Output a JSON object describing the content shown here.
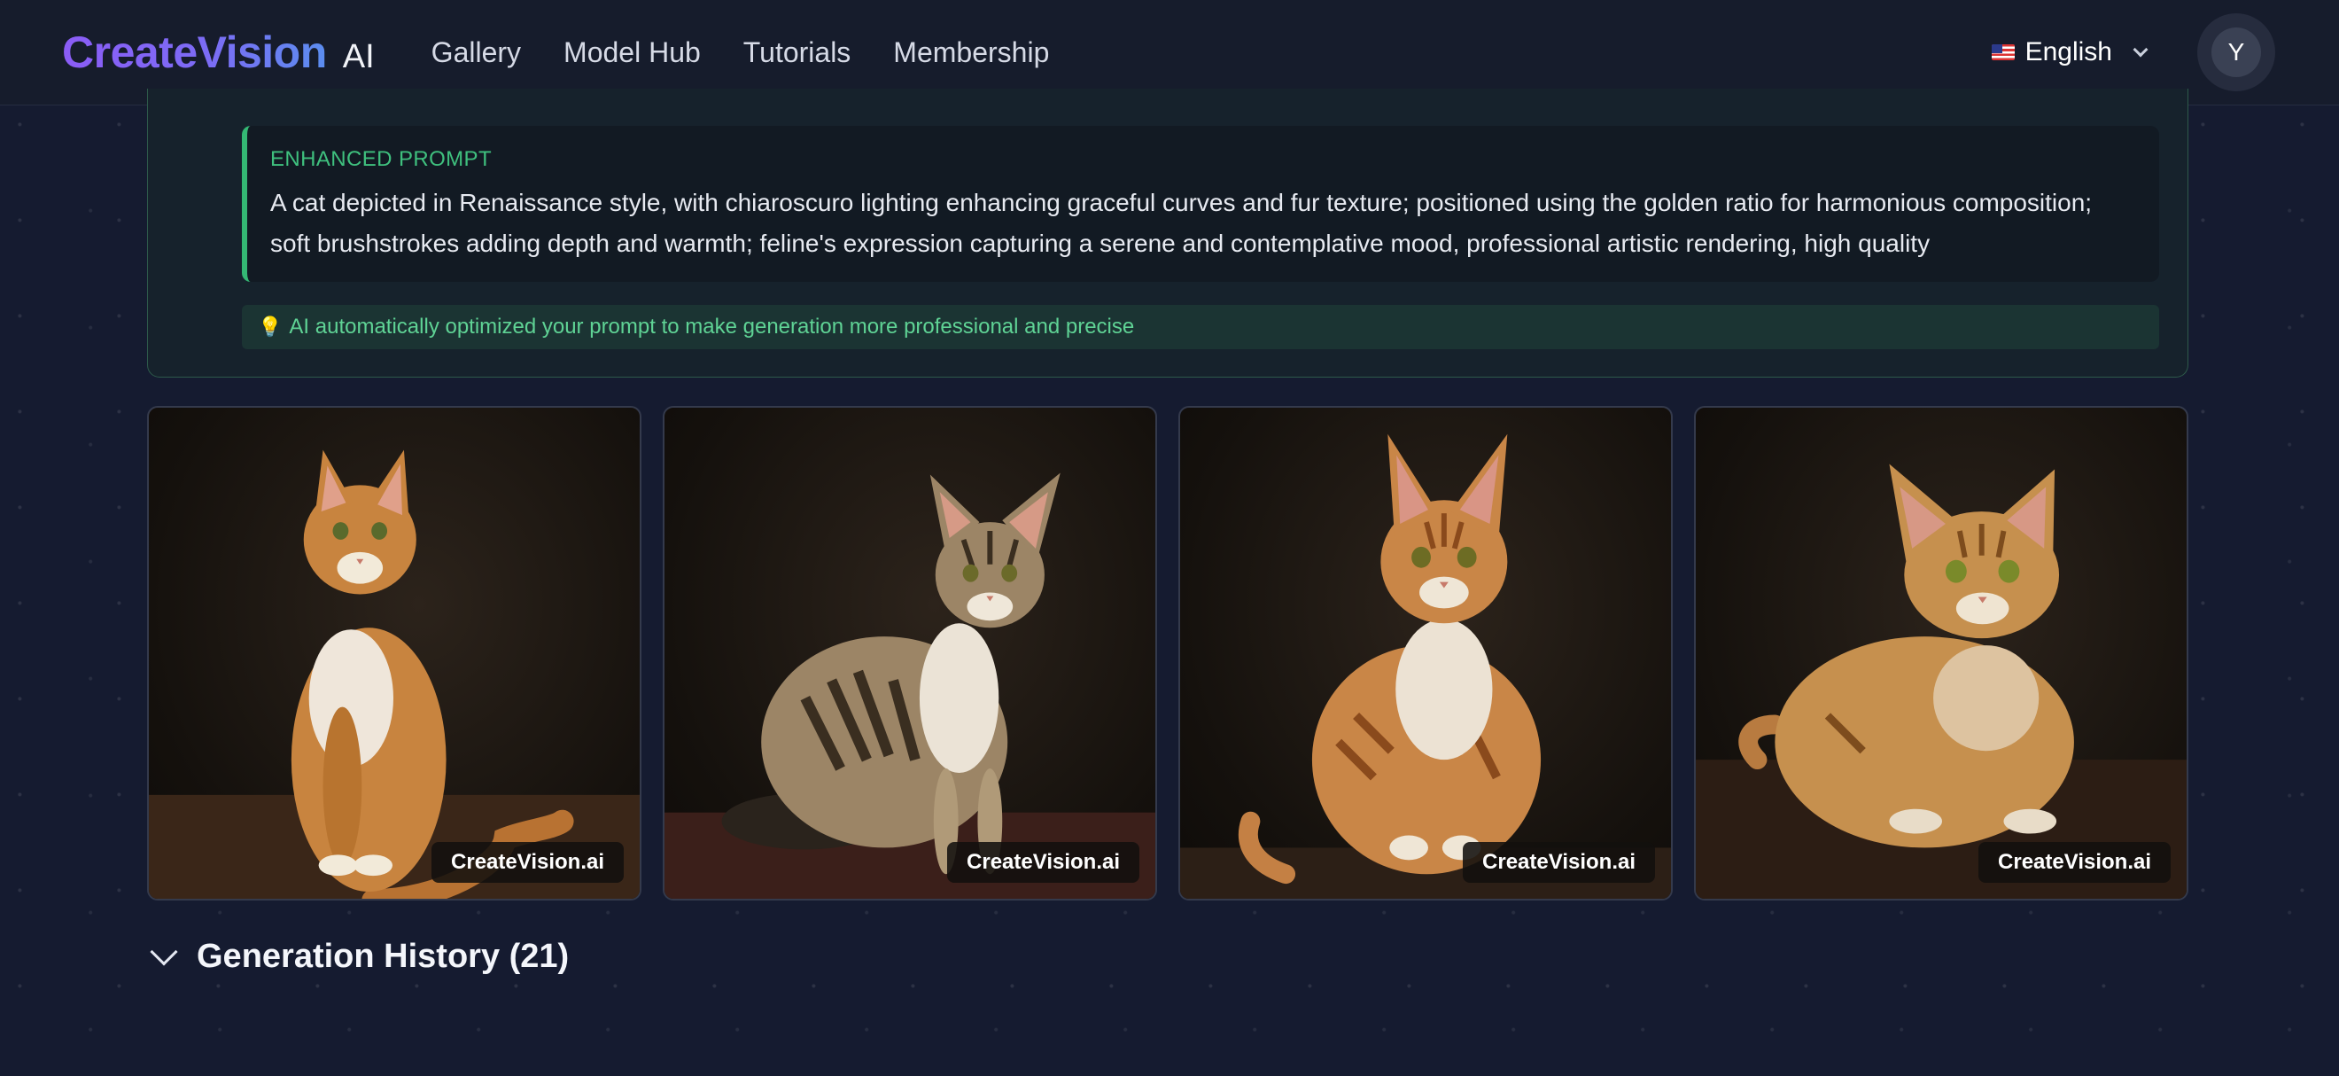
{
  "header": {
    "logo_main": "CreateVision",
    "logo_ai": "AI",
    "nav": [
      "Gallery",
      "Model Hub",
      "Tutorials",
      "Membership"
    ],
    "language": "English",
    "avatar_initial": "Y"
  },
  "prompt": {
    "title": "ENHANCED PROMPT",
    "text": "A cat depicted in Renaissance style, with chiaroscuro lighting enhancing graceful curves and fur texture; positioned using the golden ratio for harmonious composition; soft brushstrokes adding depth and warmth; feline's expression capturing a serene and contemplative mood, professional artistic rendering, high quality",
    "tip": "AI automatically optimized your prompt to make generation more professional and precise"
  },
  "images": [
    {
      "watermark": "CreateVision.ai",
      "fur": "#c8843f",
      "dark": "#7a4418"
    },
    {
      "watermark": "CreateVision.ai",
      "fur": "#9c8566",
      "dark": "#3a2e20"
    },
    {
      "watermark": "CreateVision.ai",
      "fur": "#c98647",
      "dark": "#8a4a1c"
    },
    {
      "watermark": "CreateVision.ai",
      "fur": "#c6904e",
      "dark": "#7d4c1d"
    }
  ],
  "history": {
    "label": "Generation History (21)"
  },
  "colors": {
    "accent_green": "#3fc07e",
    "logo_purple": "#8b5cf6",
    "background": "#151b30"
  }
}
